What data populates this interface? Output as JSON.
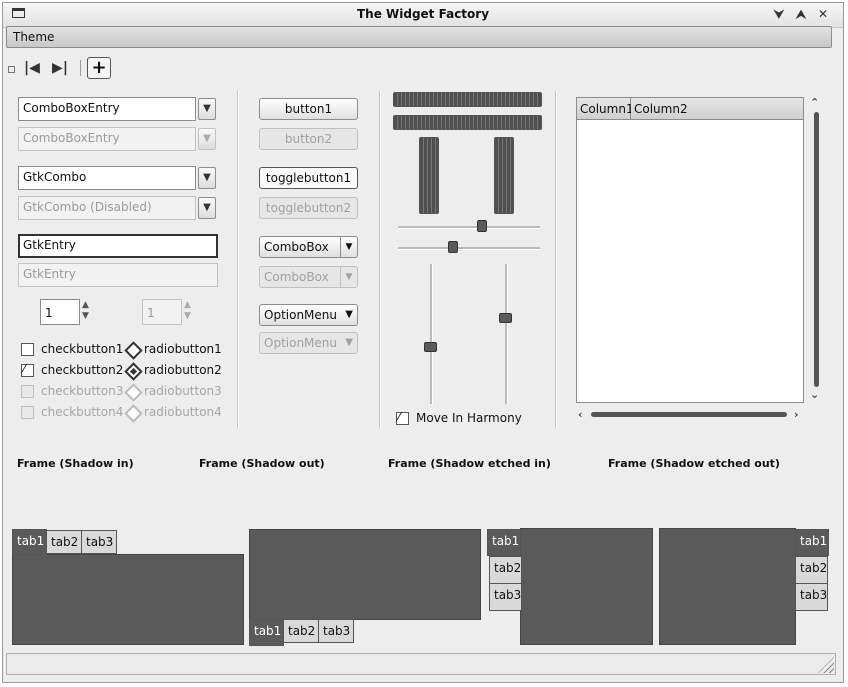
{
  "window": {
    "title": "The Widget Factory"
  },
  "menubar": {
    "items": [
      "Theme"
    ]
  },
  "toolbar": {
    "first_icon": "first-icon",
    "last_icon": "last-icon",
    "add_icon": "add-icon"
  },
  "left": {
    "combo1": "ComboBoxEntry",
    "combo2": "ComboBoxEntry",
    "gtkcombo1": "GtkCombo",
    "gtkcombo2": "GtkCombo (Disabled)",
    "entry1": "GtkEntry",
    "entry2": "GtkEntry",
    "spin1": "1",
    "spin2": "1",
    "check1": "checkbutton1",
    "check2": "checkbutton2",
    "check3": "checkbutton3",
    "check4": "checkbutton4",
    "radio1": "radiobutton1",
    "radio2": "radiobutton2",
    "radio3": "radiobutton3",
    "radio4": "radiobutton4"
  },
  "middle": {
    "button1": "button1",
    "button2": "button2",
    "toggle1": "togglebutton1",
    "toggle2": "togglebutton2",
    "combobox1": "ComboBox",
    "combobox2": "ComboBox",
    "option1": "OptionMenu",
    "option2": "OptionMenu"
  },
  "sliders": {
    "harmony_label": "Move In Harmony",
    "harmony_checked": true
  },
  "tree": {
    "columns": [
      "Column1",
      "Column2"
    ]
  },
  "frames": [
    "Frame (Shadow in)",
    "Frame (Shadow out)",
    "Frame (Shadow etched in)",
    "Frame (Shadow etched out)"
  ],
  "notebooks": [
    {
      "tabs": [
        "tab1",
        "tab2",
        "tab3"
      ],
      "position": "top"
    },
    {
      "tabs": [
        "tab1",
        "tab2",
        "tab3"
      ],
      "position": "bottom"
    },
    {
      "tabs": [
        "tab1",
        "tab2",
        "tab3"
      ],
      "position": "left"
    },
    {
      "tabs": [
        "tab1",
        "tab2",
        "tab3"
      ],
      "position": "right"
    }
  ]
}
